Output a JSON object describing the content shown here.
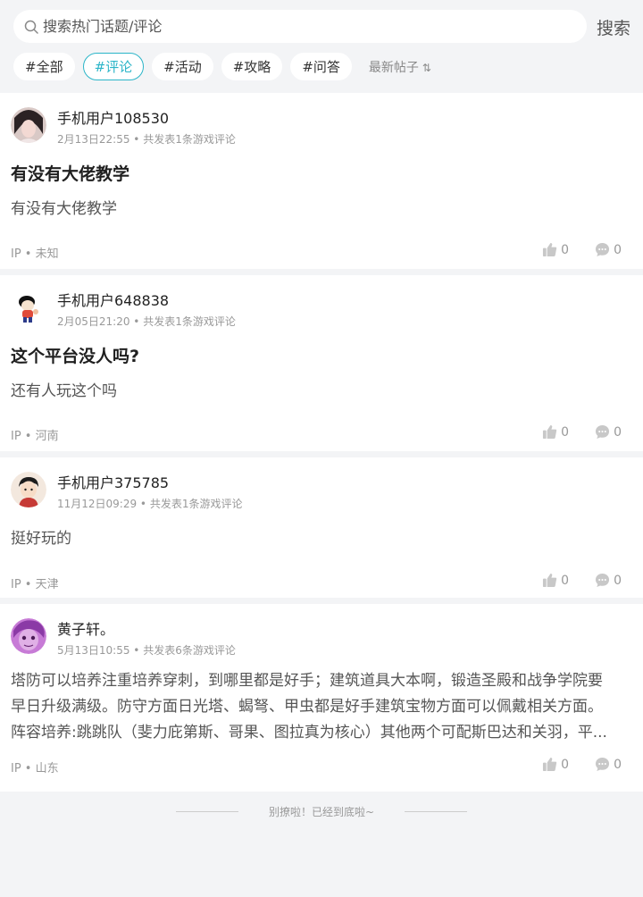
{
  "search": {
    "placeholder": "搜索热门话题/评论",
    "button": "搜索"
  },
  "tags": [
    "#全部",
    "#评论",
    "#活动",
    "#攻略",
    "#问答"
  ],
  "sort_label": "最新帖子",
  "posts": [
    {
      "user": "手机用户108530",
      "meta": "2月13日22:55 • 共发表1条游戏评论",
      "title": "有没有大佬教学",
      "body": "有没有大佬教学",
      "ip": "IP • 未知",
      "likes": "0",
      "comments": "0"
    },
    {
      "user": "手机用户648838",
      "meta": "2月05日21:20 • 共发表1条游戏评论",
      "title": "这个平台没人吗?",
      "body": "还有人玩这个吗",
      "ip": "IP • 河南",
      "likes": "0",
      "comments": "0"
    },
    {
      "user": "手机用户375785",
      "meta": "11月12日09:29 • 共发表1条游戏评论",
      "title": "",
      "body": "挺好玩的",
      "ip": "IP • 天津",
      "likes": "0",
      "comments": "0"
    },
    {
      "user": "黄子轩。",
      "meta": "5月13日10:55 • 共发表6条游戏评论",
      "title": "",
      "body_lines": [
        "塔防可以培养注重培养穿刺，到哪里都是好手；建筑道具大本啊，锻造圣殿和战争学院要",
        "早日升级满级。防守方面日光塔、蝎弩、甲虫都是好手建筑宝物方面可以佩戴相关方面。",
        "阵容培养:跳跳队（斐力庇第斯、哥果、图拉真为核心）其他两个可配斯巴达和关羽，平..."
      ],
      "ip": "IP • 山东",
      "likes": "0",
      "comments": "0"
    }
  ],
  "end_text": "别撩啦！已经到底啦~",
  "colors": {
    "accent": "#2bb5c8",
    "background": "#f3f4f6"
  }
}
